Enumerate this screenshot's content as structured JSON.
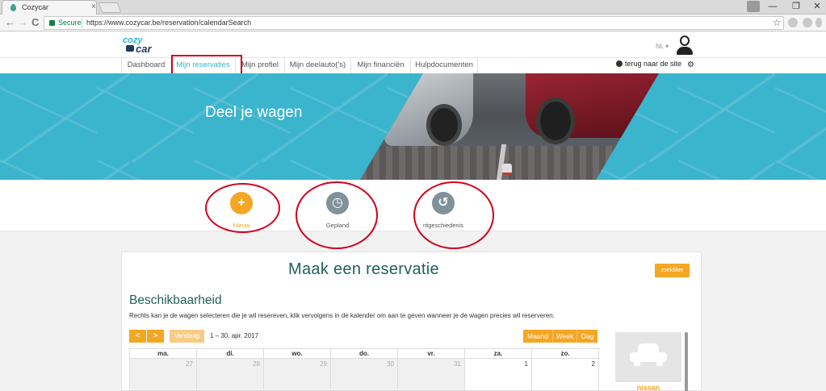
{
  "browser": {
    "tab_title": "Cozycar",
    "tab_close": "×",
    "secure_label": "Secure",
    "url": "https://www.cozycar.be/reservation/calendarSearch",
    "back": "←",
    "forward": "→",
    "reload": "C",
    "star": "☆",
    "win_minimize": "—",
    "win_restore": "❐",
    "win_close": "✕"
  },
  "header": {
    "logo_top": "cozy",
    "logo_bottom": "car",
    "language": "NL ▾"
  },
  "nav": {
    "items": [
      {
        "label": "Dashboard"
      },
      {
        "label": "Mijn reservaties"
      },
      {
        "label": "Mijn profiel"
      },
      {
        "label": "Mijn deelauto('s)"
      },
      {
        "label": "Mijn financiën"
      },
      {
        "label": "Hulpdocumenten"
      }
    ],
    "back_to_site": "terug naar de site",
    "settings_glyph": "⚙"
  },
  "hero": {
    "title": "Deel je wagen"
  },
  "actions": [
    {
      "label": "Nieuw",
      "glyph": "+",
      "color": "#f5a623"
    },
    {
      "label": "Gepland",
      "glyph": "◷",
      "color": "#7f929b"
    },
    {
      "label": "ritgeschiedenis",
      "glyph": "↺",
      "color": "#7f929b"
    }
  ],
  "panel": {
    "title": "Maak een reservatie",
    "zoekfilter": "zoekfilter",
    "section_title": "Beschikbaarheid",
    "section_desc": "Rechts kan je de wagen selecteren die je wil resereven, klik vervolgens in de kalender om aan te geven wanneer je de wagen precies wil reserveren."
  },
  "calendar": {
    "prev": "<",
    "next": ">",
    "today": "Vandaag",
    "range": "1 – 30. apr. 2017",
    "views": [
      "Maand",
      "Week",
      "Dag"
    ],
    "weekdays": [
      "ma.",
      "di.",
      "wo.",
      "do.",
      "vr.",
      "za.",
      "zo."
    ],
    "first_row": [
      "27",
      "28",
      "29",
      "30",
      "31",
      "1",
      "2"
    ]
  },
  "car": {
    "name": "nissan"
  },
  "colors": {
    "accent": "#f5a623",
    "brand": "#31b6c7",
    "heading": "#1f5f5b",
    "annotation": "#d0021b"
  }
}
